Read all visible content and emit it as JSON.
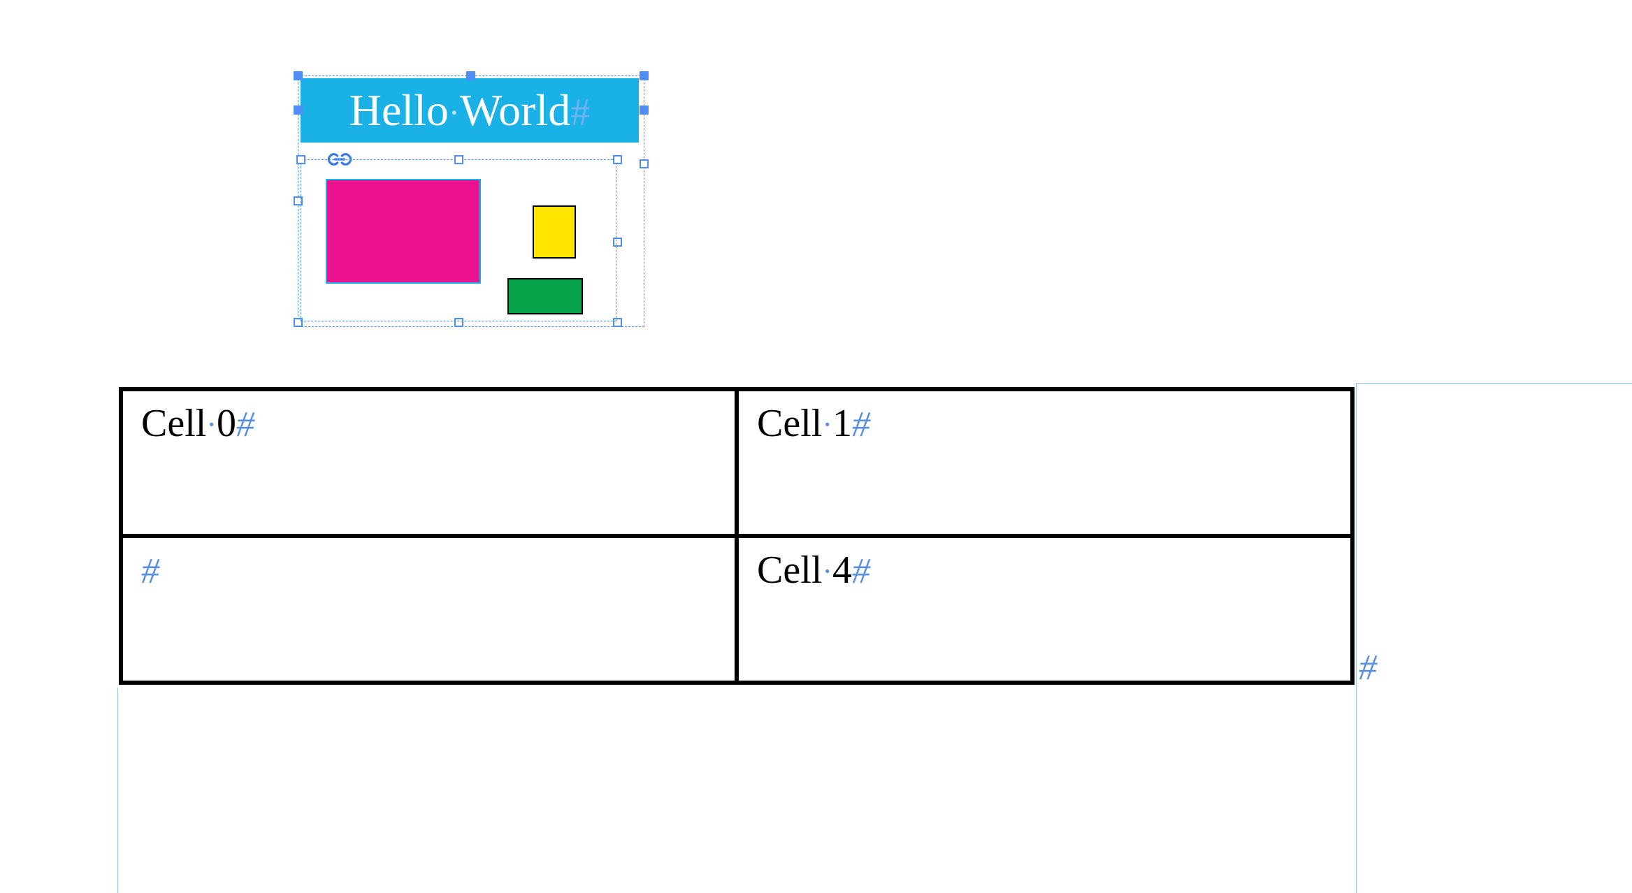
{
  "group": {
    "text_frame": {
      "text": "Hello World",
      "word1": "Hello",
      "word2": "World",
      "space_glyph": "·",
      "para_glyph": "#"
    },
    "link_icon_name": "link-icon",
    "graphic": {
      "rects": [
        "magenta",
        "yellow",
        "green"
      ]
    }
  },
  "table": {
    "rows": [
      {
        "cells": [
          {
            "label_word": "Cell",
            "label_num": "0"
          },
          {
            "label_word": "Cell",
            "label_num": "1"
          }
        ]
      },
      {
        "cells": [
          {
            "label_word": "",
            "label_num": ""
          },
          {
            "label_word": "Cell",
            "label_num": "4"
          }
        ]
      }
    ],
    "space_glyph": "·",
    "para_glyph": "#"
  },
  "after_table_para_glyph": "#"
}
